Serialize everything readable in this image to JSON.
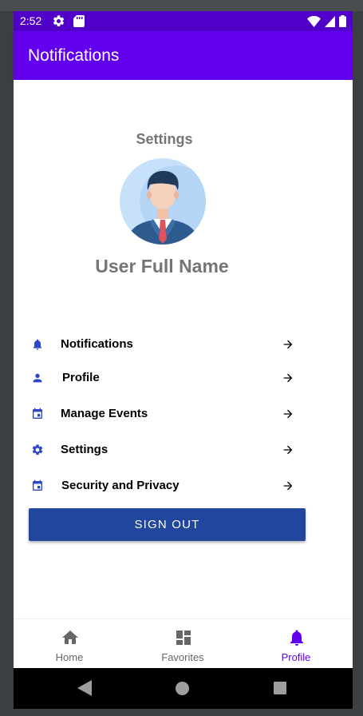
{
  "status_bar": {
    "time": "2:52"
  },
  "app_bar": {
    "title": "Notifications"
  },
  "profile": {
    "section_title": "Settings",
    "user_name": "User Full Name"
  },
  "menu": {
    "items": [
      {
        "label": "Notifications",
        "icon": "bell-icon"
      },
      {
        "label": "Profile",
        "icon": "person-icon"
      },
      {
        "label": "Manage Events",
        "icon": "calendar-icon"
      },
      {
        "label": "Settings",
        "icon": "gear-icon"
      },
      {
        "label": "Security and Privacy",
        "icon": "calendar-icon"
      }
    ]
  },
  "sign_out_label": "SIGN OUT",
  "bottom_nav": {
    "items": [
      {
        "label": "Home",
        "icon": "home-icon"
      },
      {
        "label": "Favorites",
        "icon": "dashboard-icon"
      },
      {
        "label": "Profile",
        "icon": "bell-icon",
        "active": true
      }
    ]
  },
  "colors": {
    "status_bar": "#5000c8",
    "app_bar": "#6200ee",
    "menu_icon": "#2b46c6",
    "sign_out_button": "#21469e",
    "nav_active": "#6200ee",
    "nav_inactive": "#666666"
  }
}
